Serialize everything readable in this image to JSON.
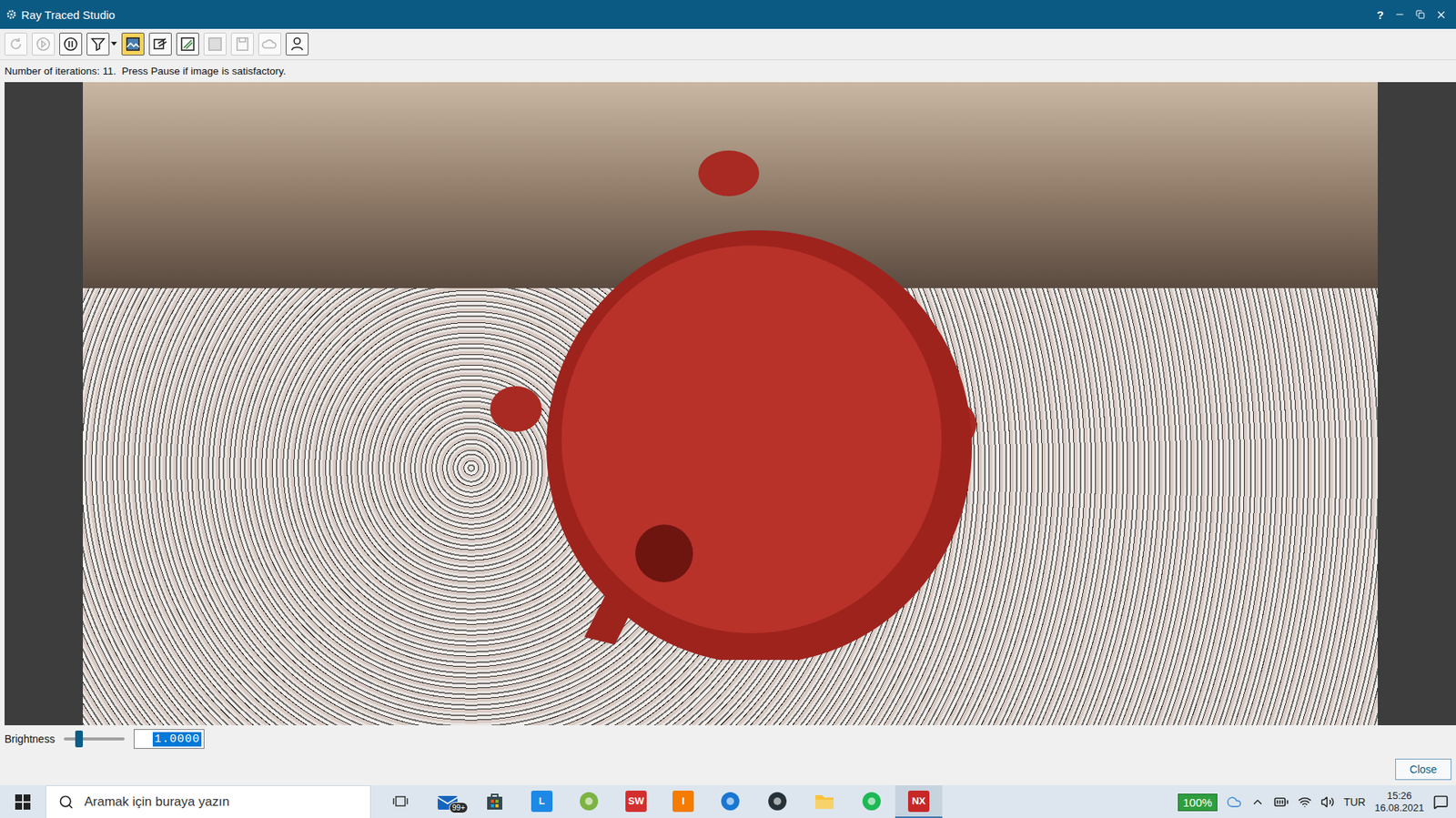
{
  "window": {
    "title": "Ray Traced Studio",
    "help": "?"
  },
  "toolbar": [
    {
      "kind": "refresh",
      "disabled": true,
      "active": false
    },
    {
      "kind": "play",
      "disabled": true,
      "active": false
    },
    {
      "kind": "pause",
      "disabled": false,
      "active": false
    },
    {
      "kind": "filter",
      "disabled": false,
      "active": false
    },
    {
      "kind": "background",
      "disabled": false,
      "active": true
    },
    {
      "kind": "material",
      "disabled": false,
      "active": false
    },
    {
      "kind": "edit",
      "disabled": false,
      "active": false
    },
    {
      "kind": "sheet",
      "disabled": true,
      "active": false
    },
    {
      "kind": "save",
      "disabled": true,
      "active": false
    },
    {
      "kind": "cloud",
      "disabled": true,
      "active": false
    },
    {
      "kind": "person",
      "disabled": false,
      "active": false
    }
  ],
  "status": "Number of iterations: 11.  Press Pause if image is satisfactory.",
  "brightness": {
    "label": "Brightness",
    "level": 0.25,
    "value": "1.0000",
    "selected": true
  },
  "buttons": [
    "Close"
  ],
  "taskbar": {
    "search_placeholder": "Aramak için buraya yazın",
    "apps": [
      {
        "kind": "task-view",
        "label": "",
        "badge": "",
        "color": "#333333",
        "active": false
      },
      {
        "kind": "mail",
        "label": "",
        "badge": "99+",
        "color": "#1565c0",
        "active": false
      },
      {
        "kind": "store",
        "label": "",
        "badge": "",
        "color": "#37474f",
        "active": false
      },
      {
        "kind": "tile",
        "label": "L",
        "badge": "",
        "color": "#1e88e5",
        "active": false
      },
      {
        "kind": "app",
        "label": "",
        "badge": "",
        "color": "#7cb342",
        "active": false
      },
      {
        "kind": "tile",
        "label": "SW",
        "badge": "",
        "color": "#d32f2f",
        "active": false
      },
      {
        "kind": "tile",
        "label": "I",
        "badge": "",
        "color": "#f57c00",
        "active": false
      },
      {
        "kind": "app",
        "label": "",
        "badge": "",
        "color": "#1976d2",
        "active": false
      },
      {
        "kind": "app",
        "label": "",
        "badge": "",
        "color": "#263238",
        "active": false
      },
      {
        "kind": "folder",
        "label": "",
        "badge": "",
        "color": "#f9c33c",
        "active": false
      },
      {
        "kind": "app",
        "label": "",
        "badge": "",
        "color": "#1db954",
        "active": false
      },
      {
        "kind": "tile",
        "label": "NX",
        "badge": "",
        "color": "#c62828",
        "active": true
      }
    ],
    "battery": "100%",
    "language": "TUR",
    "time": "15:26",
    "date": "16.08.2021"
  }
}
